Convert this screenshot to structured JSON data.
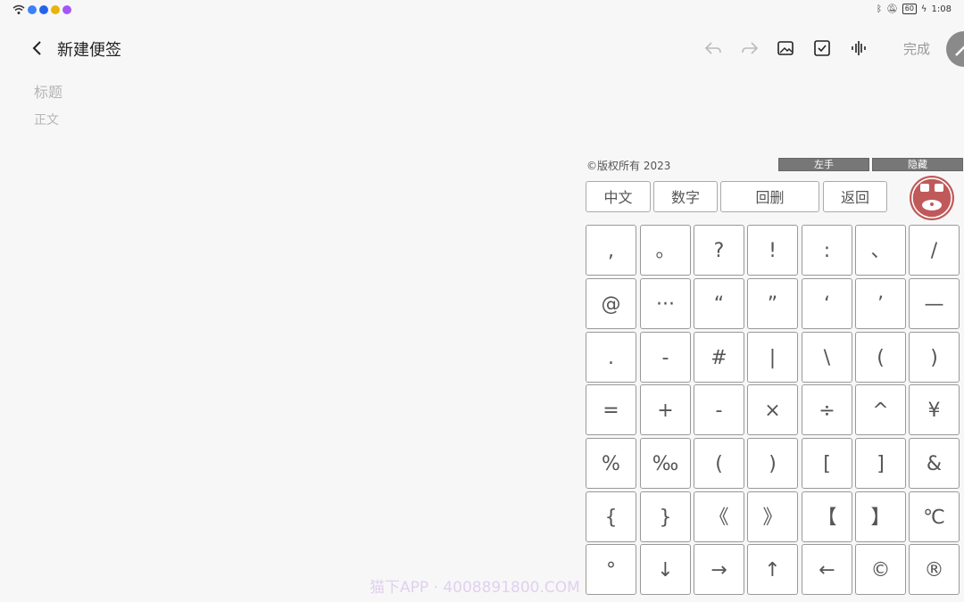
{
  "status_bar": {
    "battery": "60",
    "time": "1:08"
  },
  "header": {
    "title": "新建便签",
    "done_label": "完成"
  },
  "note": {
    "title_placeholder": "标题",
    "body_placeholder": "正文"
  },
  "keyboard": {
    "copyright": "©版权所有 2023",
    "left_hand_label": "左手",
    "hide_label": "隐藏",
    "modes": [
      "中文",
      "数字",
      "回删",
      "返回"
    ],
    "rows": [
      [
        ",",
        "。",
        "?",
        "!",
        ":",
        "、",
        "/"
      ],
      [
        "@",
        "···",
        "“",
        "”",
        "‘",
        "’",
        "—"
      ],
      [
        ".",
        "-",
        "#",
        "|",
        "\\",
        "(",
        ")"
      ],
      [
        "=",
        "+",
        "-",
        "×",
        "÷",
        "^",
        "¥"
      ],
      [
        "%",
        "‰",
        "(",
        ")",
        "[",
        "]",
        "&"
      ],
      [
        "{",
        "}",
        "《",
        "》",
        "【",
        "】",
        "℃"
      ],
      [
        "°",
        "↓",
        "→",
        "↑",
        "←",
        "©",
        "®"
      ]
    ]
  },
  "watermark": "猫下APP · 4008891800.COM",
  "colors": {
    "background": "#f7f7f7",
    "logo_red": "#c05a5a"
  }
}
